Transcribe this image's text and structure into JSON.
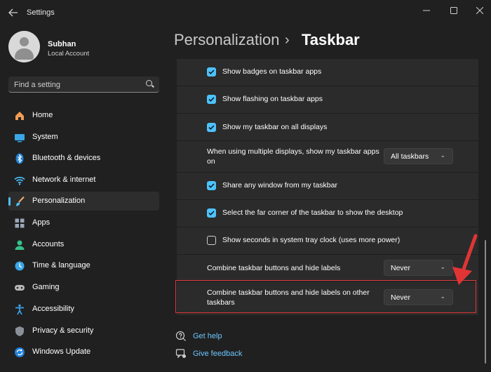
{
  "window": {
    "title": "Settings"
  },
  "profile": {
    "name": "Subhan",
    "account": "Local Account"
  },
  "search": {
    "placeholder": "Find a setting"
  },
  "nav": {
    "items": [
      {
        "label": "Home"
      },
      {
        "label": "System"
      },
      {
        "label": "Bluetooth & devices"
      },
      {
        "label": "Network & internet"
      },
      {
        "label": "Personalization"
      },
      {
        "label": "Apps"
      },
      {
        "label": "Accounts"
      },
      {
        "label": "Time & language"
      },
      {
        "label": "Gaming"
      },
      {
        "label": "Accessibility"
      },
      {
        "label": "Privacy & security"
      },
      {
        "label": "Windows Update"
      }
    ],
    "selected": "Personalization"
  },
  "header": {
    "parent": "Personalization",
    "separator": "›",
    "current": "Taskbar"
  },
  "settings": {
    "badges": {
      "label": "Show badges on taskbar apps",
      "checked": true
    },
    "flashing": {
      "label": "Show flashing on taskbar apps",
      "checked": true
    },
    "all_displays": {
      "label": "Show my taskbar on all displays",
      "checked": true
    },
    "multi_display": {
      "label": "When using multiple displays, show my taskbar apps on",
      "value": "All taskbars"
    },
    "share_window": {
      "label": "Share any window from my taskbar",
      "checked": true
    },
    "far_corner": {
      "label": "Select the far corner of the taskbar to show the desktop",
      "checked": true
    },
    "seconds": {
      "label": "Show seconds in system tray clock (uses more power)",
      "checked": false
    },
    "combine": {
      "label": "Combine taskbar buttons and hide labels",
      "value": "Never"
    },
    "combine_other": {
      "label": "Combine taskbar buttons and hide labels on other taskbars",
      "value": "Never"
    }
  },
  "links": {
    "help": "Get help",
    "feedback": "Give feedback"
  },
  "colors": {
    "accent": "#4cc2ff",
    "highlight": "#e03535",
    "background": "#202020",
    "card": "#2b2b2b"
  }
}
